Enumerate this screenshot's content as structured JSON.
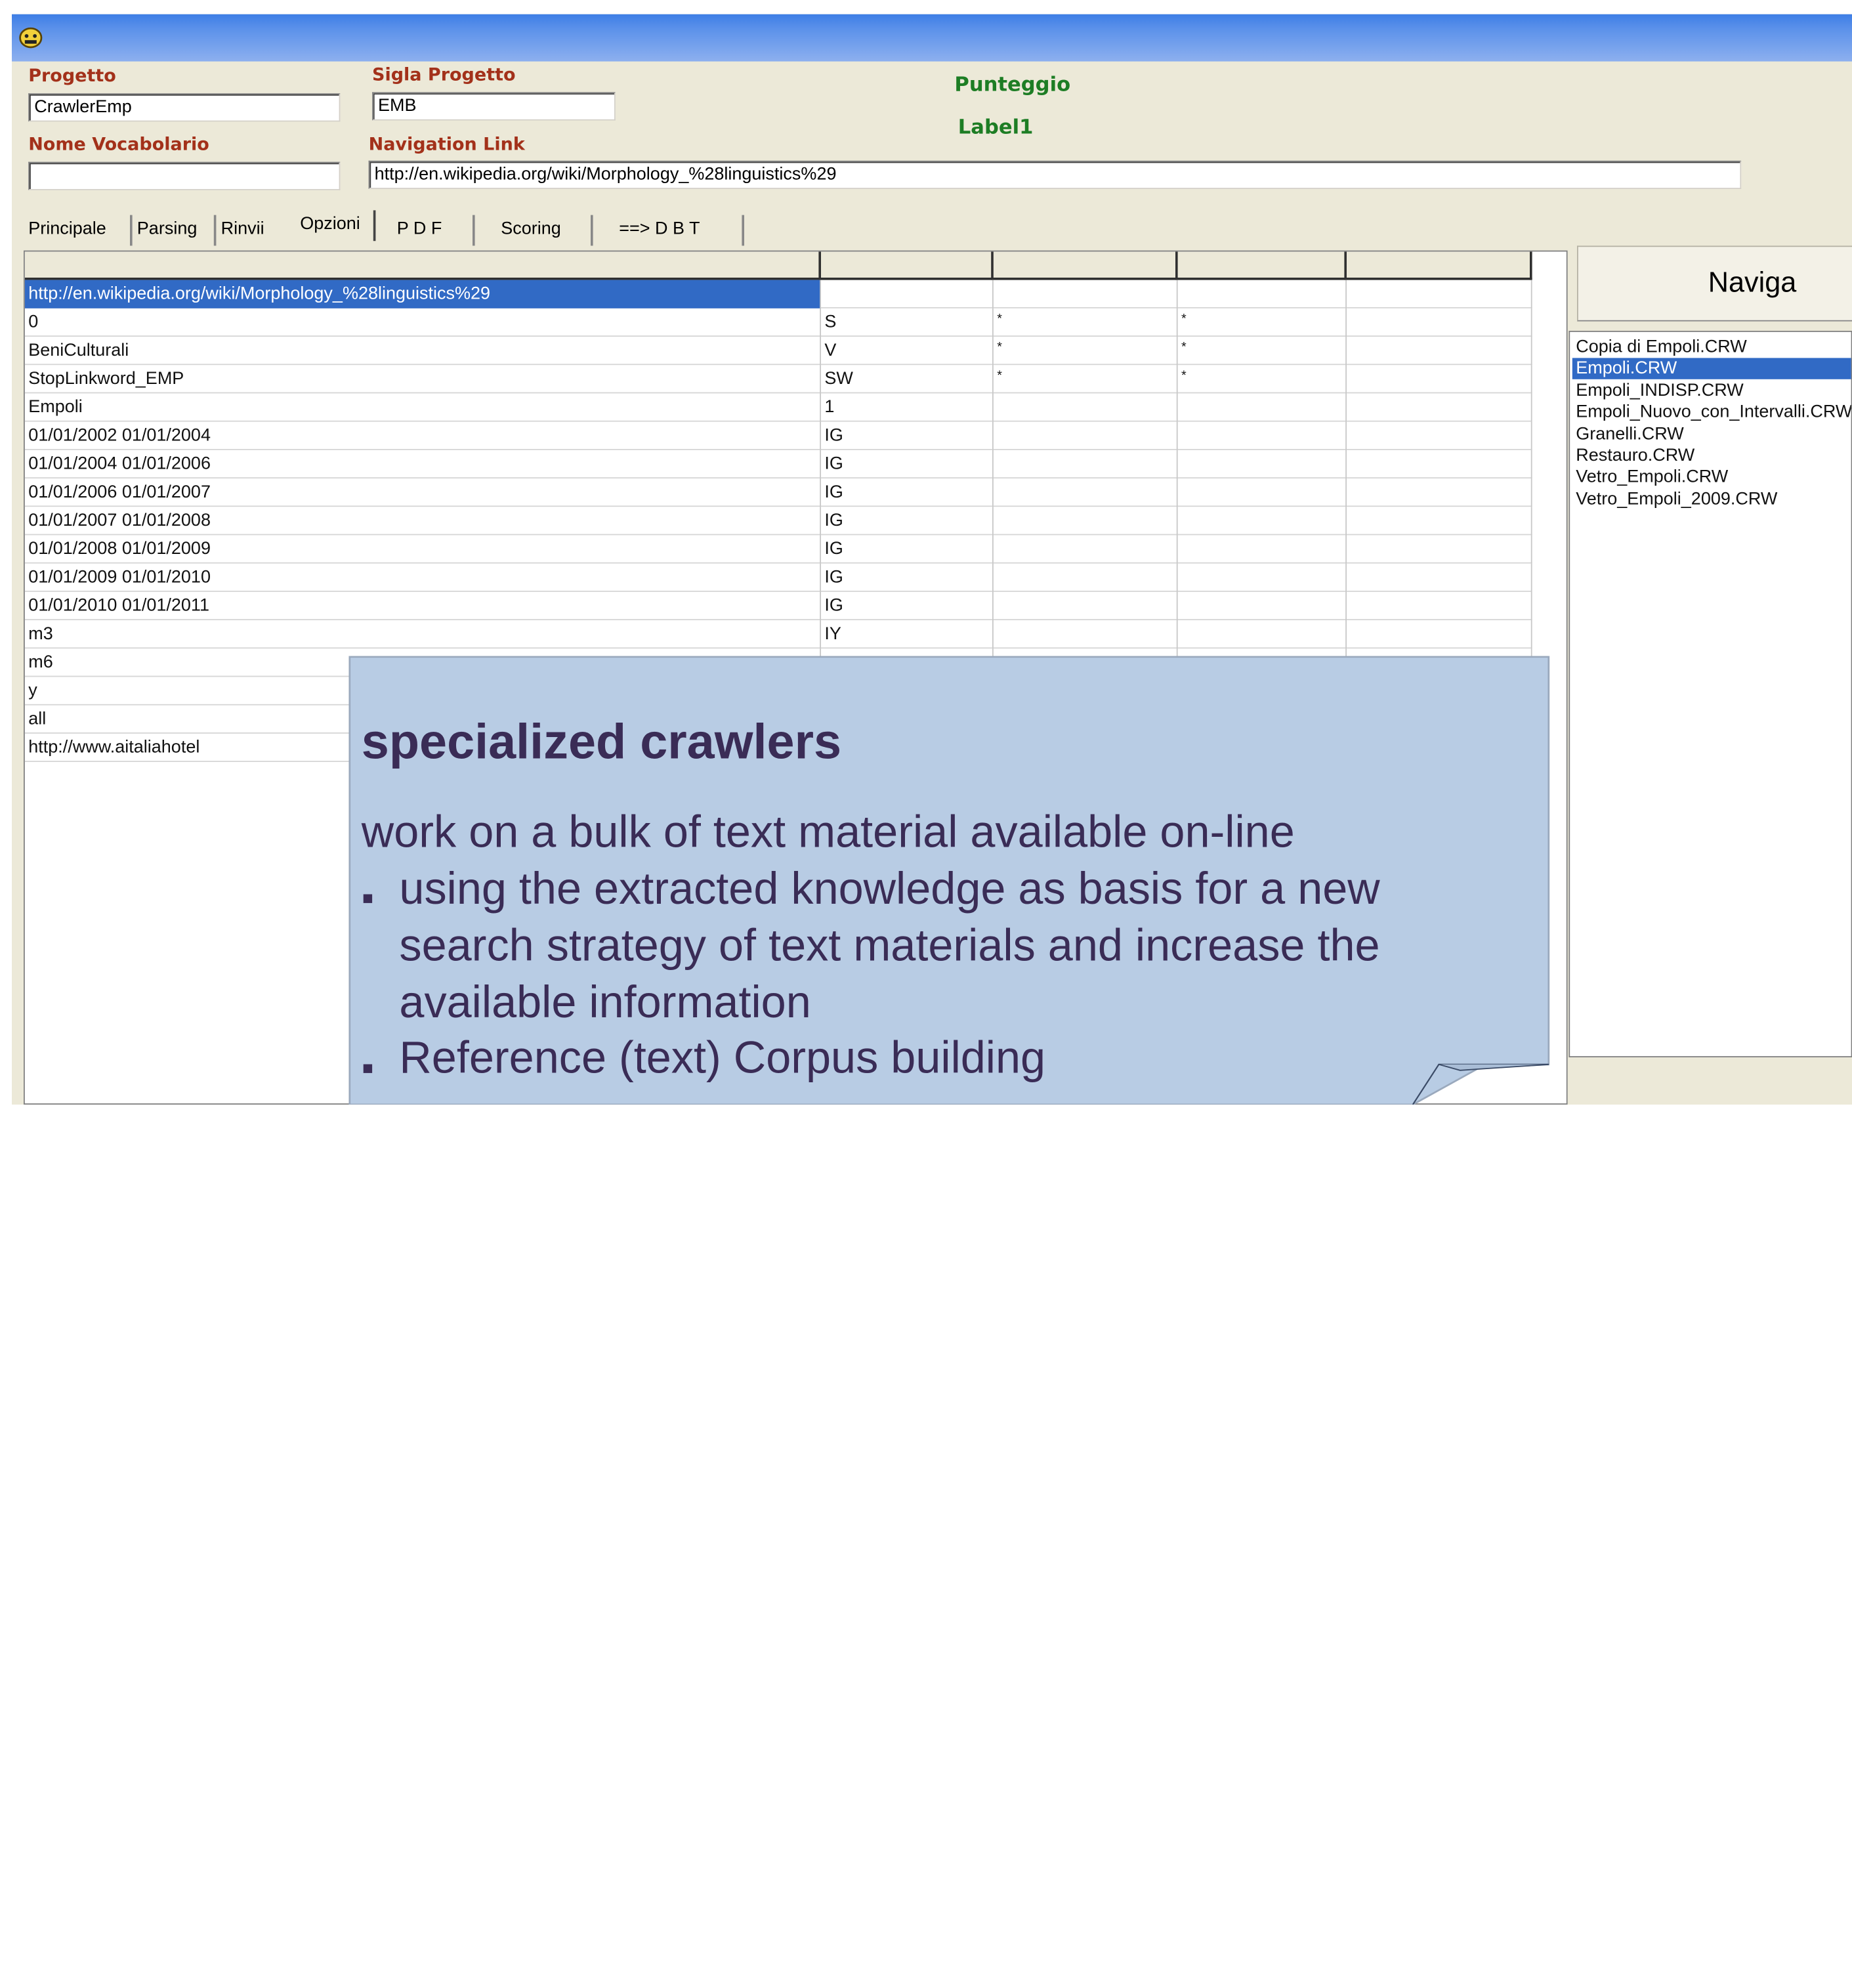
{
  "form": {
    "progetto_label": "Progetto",
    "progetto_value": "CrawlerEmp",
    "sigla_label": "Sigla Progetto",
    "sigla_value": "EMB",
    "vocabolario_label": "Nome Vocabolario",
    "vocabolario_value": "",
    "navlink_label": "Navigation Link",
    "navlink_value": "http://en.wikipedia.org/wiki/Morphology_%28linguistics%29",
    "punteggio_label": "Punteggio",
    "label1": "Label1"
  },
  "tabs": [
    "Principale",
    "Parsing",
    "Rinvii",
    "Opzioni",
    "P D F",
    "Scoring",
    "==> D B T"
  ],
  "active_tab": "Opzioni",
  "grid": {
    "rows": [
      [
        "http://en.wikipedia.org/wiki/Morphology_%28linguistics%29",
        "",
        "",
        "",
        ""
      ],
      [
        "0",
        "S",
        "*",
        "*",
        ""
      ],
      [
        "BeniCulturali",
        "V",
        "*",
        "*",
        ""
      ],
      [
        "StopLinkword_EMP",
        "SW",
        "*",
        "*",
        ""
      ],
      [
        "Empoli",
        "1",
        "",
        "",
        ""
      ],
      [
        "01/01/2002 01/01/2004",
        "IG",
        "",
        "",
        ""
      ],
      [
        "01/01/2004 01/01/2006",
        "IG",
        "",
        "",
        ""
      ],
      [
        "01/01/2006 01/01/2007",
        "IG",
        "",
        "",
        ""
      ],
      [
        "01/01/2007 01/01/2008",
        "IG",
        "",
        "",
        ""
      ],
      [
        "01/01/2008 01/01/2009",
        "IG",
        "",
        "",
        ""
      ],
      [
        "01/01/2009 01/01/2010",
        "IG",
        "",
        "",
        ""
      ],
      [
        "01/01/2010 01/01/2011",
        "IG",
        "",
        "",
        ""
      ],
      [
        "m3",
        "IY",
        "",
        "",
        ""
      ],
      [
        "m6",
        "",
        "",
        "",
        ""
      ],
      [
        "y",
        "",
        "",
        "",
        ""
      ],
      [
        "all",
        "",
        "",
        "",
        ""
      ],
      [
        "http://www.aitaliahotel",
        "",
        "",
        "",
        ""
      ]
    ]
  },
  "naviga_button": "Naviga",
  "files": [
    "Copia di Empoli.CRW",
    "Empoli.CRW",
    "Empoli_INDISP.CRW",
    "Empoli_Nuovo_con_Intervalli.CRW",
    "Granelli.CRW",
    "Restauro.CRW",
    "Vetro_Empoli.CRW",
    "Vetro_Empoli_2009.CRW"
  ],
  "selected_file": "Empoli.CRW",
  "callout": {
    "title": "specialized crawlers",
    "line1": "work on a bulk of text material available on-line",
    "bullet1_line1": "using the extracted knowledge as basis for a new",
    "bullet1_line2": "search strategy of text materials and increase the",
    "bullet1_line3": "available information",
    "bullet2": "Reference (text) Corpus building"
  },
  "colors": {
    "label_red": "#a3311a",
    "label_green": "#1d7d24",
    "selection": "#316ac5",
    "callout_fill": "#b8cce4",
    "callout_text": "#3a2c56"
  }
}
